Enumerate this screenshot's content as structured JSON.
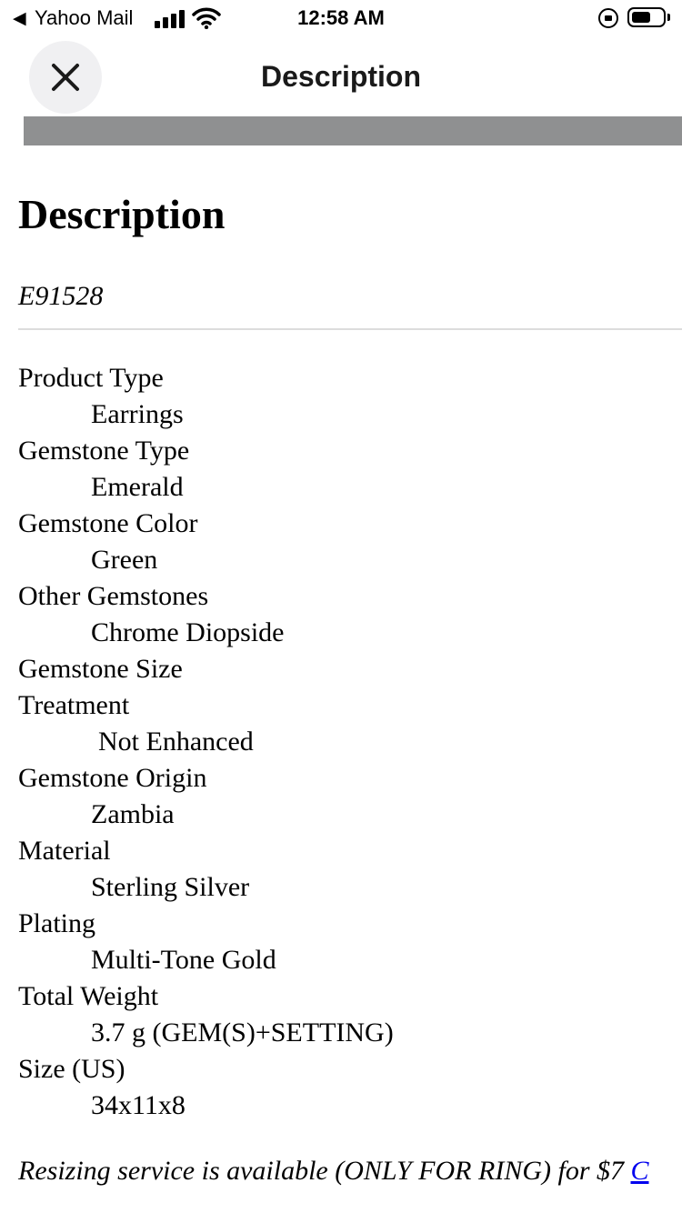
{
  "status_bar": {
    "back_arrow": "◀",
    "app_name": "Yahoo Mail",
    "time": "12:58 AM",
    "icons": [
      "signal-icon",
      "wifi-icon",
      "orientation-lock-icon",
      "battery-icon"
    ]
  },
  "nav": {
    "title": "Description",
    "close_icon": "close-icon"
  },
  "content": {
    "heading": "Description",
    "sku": "E91528",
    "specs": [
      {
        "label": "Product Type",
        "value": "Earrings"
      },
      {
        "label": "Gemstone Type",
        "value": "Emerald"
      },
      {
        "label": "Gemstone Color",
        "value": "Green"
      },
      {
        "label": "Other Gemstones",
        "value": "Chrome Diopside"
      },
      {
        "label": "Gemstone Size",
        "value": ""
      },
      {
        "label": "Treatment",
        "value": "Not Enhanced"
      },
      {
        "label": "Gemstone Origin",
        "value": "Zambia"
      },
      {
        "label": "Material",
        "value": "Sterling Silver"
      },
      {
        "label": "Plating",
        "value": "Multi-Tone Gold"
      },
      {
        "label": "Total Weight",
        "value": "3.7 g (GEM(S)+SETTING)"
      },
      {
        "label": "Size (US)",
        "value": "34x11x8"
      }
    ],
    "resize_note": "Resizing service is available (ONLY FOR RING) for $7 ",
    "resize_link": "C"
  },
  "colors": {
    "close_button_bg": "#f0f0f2",
    "image_strip": "#8f9091",
    "divider": "#dcdcdc",
    "link": "#0000ee"
  }
}
